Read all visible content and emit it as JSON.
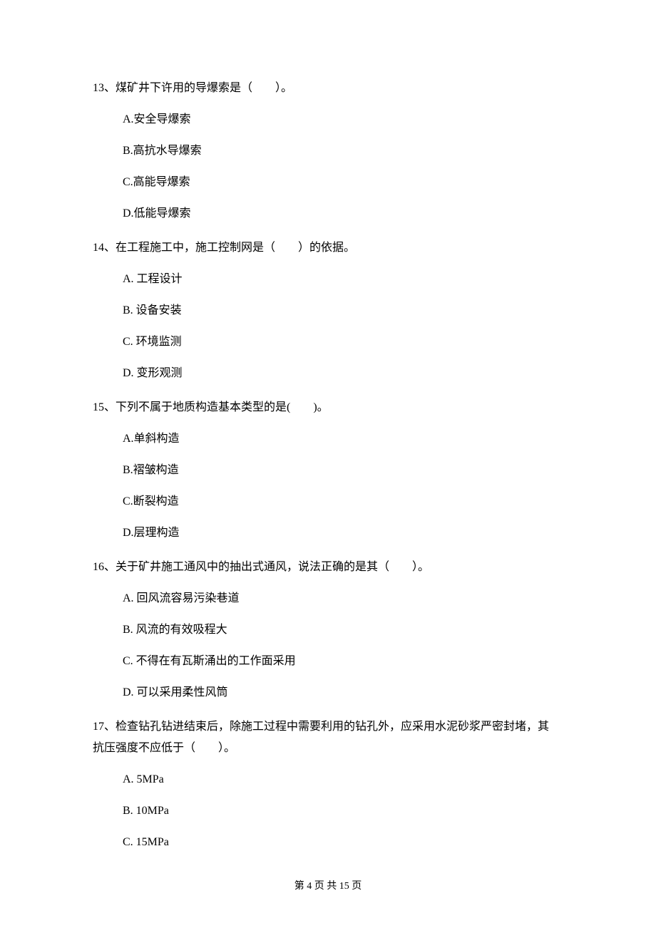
{
  "questions": [
    {
      "stem": "13、煤矿井下许用的导爆索是（　　）。",
      "options": [
        "A.安全导爆索",
        "B.高抗水导爆索",
        "C.高能导爆索",
        "D.低能导爆索"
      ]
    },
    {
      "stem": "14、在工程施工中，施工控制网是（　　）的依据。",
      "options": [
        "A.  工程设计",
        "B.  设备安装",
        "C.  环境监测",
        "D.  变形观测"
      ]
    },
    {
      "stem": "15、下列不属于地质构造基本类型的是(　　)。",
      "options": [
        "A.单斜构造",
        "B.褶皱构造",
        "C.断裂构造",
        "D.层理构造"
      ]
    },
    {
      "stem": "16、关于矿井施工通风中的抽出式通风，说法正确的是其（　　）。",
      "options": [
        "A.  回风流容易污染巷道",
        "B.  风流的有效吸程大",
        "C.  不得在有瓦斯涌出的工作面采用",
        "D.  可以采用柔性风筒"
      ]
    },
    {
      "stem": "17、检查钻孔钻进结束后，除施工过程中需要利用的钻孔外，应采用水泥砂浆严密封堵，其",
      "stem2": "抗压强度不应低于（　　）。",
      "options": [
        "A.  5MPa",
        "B.  10MPa",
        "C.  15MPa"
      ]
    }
  ],
  "footer": "第 4 页 共 15 页"
}
